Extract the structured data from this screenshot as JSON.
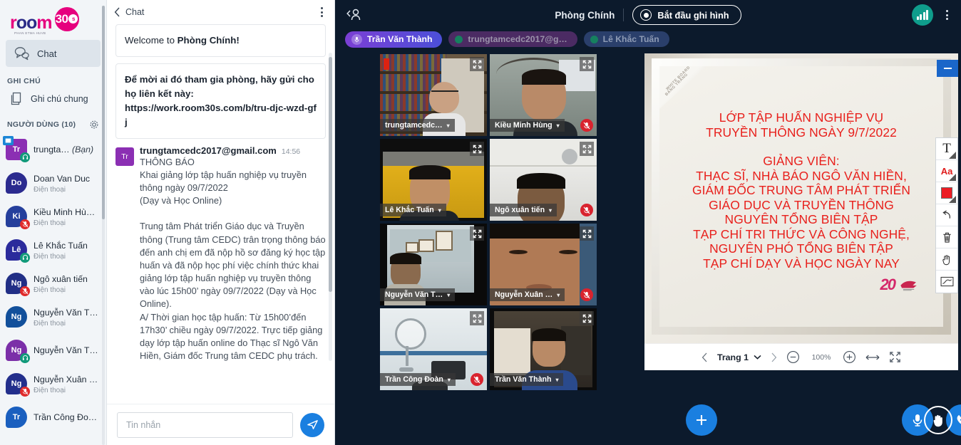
{
  "sidebar": {
    "brand": {
      "word_r": "r",
      "word_o1": "o",
      "word_o2": "o",
      "word_m": "m",
      "tagline": "PHAN ETMA HUVB",
      "badge_num": "30",
      "badge_s": "s"
    },
    "chat_item": {
      "label": "Chat",
      "icon": "chat-bubble-icon"
    },
    "notes_section_title": "GHI CHÚ",
    "notes_item": {
      "label": "Ghi chú chung",
      "icon": "document-icon"
    },
    "users_section_title": "NGƯỜI DÙNG (10)",
    "users_gear_icon": "gear-icon",
    "users": [
      {
        "initials": "Tr",
        "name": "trungta…",
        "suffix": "(Bạn)",
        "sub": "",
        "avatar_color": "#8b2fb3",
        "shape": "square",
        "badge_tl": "screen-share-icon",
        "badge_br": "headset-icon",
        "badge_br_color": "green"
      },
      {
        "initials": "Do",
        "name": "Doan Van Duc",
        "suffix": "",
        "sub": "Điện thoại",
        "avatar_color": "#2b2b8f",
        "shape": "round",
        "badge_tl": "",
        "badge_br": "",
        "badge_br_color": ""
      },
      {
        "initials": "Ki",
        "name": "Kiều Minh Hù…",
        "suffix": "",
        "sub": "Điện thoại",
        "avatar_color": "#253f9c",
        "shape": "round",
        "badge_tl": "",
        "badge_br": "mic-off-icon",
        "badge_br_color": "red"
      },
      {
        "initials": "Lê",
        "name": "Lê Khắc Tuấn",
        "suffix": "",
        "sub": "Điện thoại",
        "avatar_color": "#2b2b9c",
        "shape": "round",
        "badge_tl": "",
        "badge_br": "headset-icon",
        "badge_br_color": "green"
      },
      {
        "initials": "Ng",
        "name": "Ngô xuân tiến",
        "suffix": "",
        "sub": "Điện thoại",
        "avatar_color": "#212f86",
        "shape": "round",
        "badge_tl": "",
        "badge_br": "mic-off-icon",
        "badge_br_color": "red"
      },
      {
        "initials": "Ng",
        "name": "Nguyễn Văn T…",
        "suffix": "",
        "sub": "Điện thoại",
        "avatar_color": "#12509b",
        "shape": "round",
        "badge_tl": "",
        "badge_br": "",
        "badge_br_color": ""
      },
      {
        "initials": "Ng",
        "name": "Nguyễn Văn T…",
        "suffix": "",
        "sub": "",
        "avatar_color": "#7b2fa8",
        "shape": "round",
        "badge_tl": "",
        "badge_br": "headset-icon",
        "badge_br_color": "green"
      },
      {
        "initials": "Ng",
        "name": "Nguyễn Xuân …",
        "suffix": "",
        "sub": "Điện thoại",
        "avatar_color": "#232f8c",
        "shape": "round",
        "badge_tl": "",
        "badge_br": "mic-off-icon",
        "badge_br_color": "red"
      },
      {
        "initials": "Tr",
        "name": "Trần Công Đo…",
        "suffix": "",
        "sub": "",
        "avatar_color": "#1a5fbf",
        "shape": "round",
        "badge_tl": "",
        "badge_br": "",
        "badge_br_color": ""
      }
    ]
  },
  "chat": {
    "back_icon": "chevron-left-icon",
    "title": "Chat",
    "menu_icon": "kebab-menu-icon",
    "welcome": {
      "plain": "Welcome to ",
      "bold": "Phòng Chính!"
    },
    "invite": {
      "line1": "Để mời ai đó tham gia phòng, hãy gửi cho họ liên kết này:",
      "link": "https://work.room30s.com/b/tru-djc-wzd-gfj"
    },
    "message": {
      "avatar_initials": "Tr",
      "from": "trungtamcedc2017@gmail.com",
      "time": "14:56",
      "body": "THÔNG BÁO\nKhai giảng lớp tập huấn nghiệp vụ truyền thông ngày 09/7/2022\n(Dạy và Học Online)\n\nTrung tâm Phát triển Giáo dục và Truyền thông (Trung tâm CEDC) trân trọng thông báo đến anh chị em đã nộp hồ sơ đăng ký học tập huấn và đã nộp học phí việc chính thức khai giảng lớp tập huấn nghiệp vụ truyền thông vào lúc 15h00’ ngày 09/7/2022 (Dạy và Học Online).\nA/ Thời gian học tập huấn: Từ 15h00’đến 17h30’ chiều ngày 09/7/2022. Trực tiếp giảng dạy lớp tập huấn online do Thạc sĩ Ngô Văn Hiền, Giám đốc Trung tâm CEDC phụ trách."
    },
    "input_placeholder": "Tin nhắn",
    "send_icon": "send-paper-plane-icon"
  },
  "meeting": {
    "people_back_icon": "people-back-icon",
    "room_title": "Phòng Chính",
    "record_button": "Bắt đầu ghi hình",
    "record_icon": "record-dot-icon",
    "signal_icon": "signal-bars-icon",
    "menu_icon": "kebab-menu-icon",
    "chips": [
      {
        "label": "Trần Văn Thành",
        "style": "active",
        "icon": "mic-icon"
      },
      {
        "label": "trungtamcedc2017@g…",
        "style": "c2",
        "icon": "status-dot-icon"
      },
      {
        "label": "Lê Khắc Tuấn",
        "style": "c3",
        "icon": "status-dot-icon"
      }
    ],
    "tiles": [
      {
        "name": "trungtamcedc…",
        "muted": false,
        "selected": false,
        "scene": "bookshelf"
      },
      {
        "name": "Kiều Minh Hùng",
        "muted": true,
        "selected": false,
        "scene": "man-arch"
      },
      {
        "name": "Lê Khắc Tuấn",
        "muted": false,
        "selected": false,
        "scene": "yellow-wall"
      },
      {
        "name": "Ngô xuân tiến",
        "muted": true,
        "selected": false,
        "scene": "white-ceiling"
      },
      {
        "name": "Nguyễn Văn T…",
        "muted": false,
        "selected": false,
        "scene": "office-frames"
      },
      {
        "name": "Nguyễn Xuân …",
        "muted": true,
        "selected": false,
        "scene": "closeup-face"
      },
      {
        "name": "Trần Công Đoàn",
        "muted": true,
        "selected": false,
        "scene": "fan-wall"
      },
      {
        "name": "Trần Văn Thành",
        "muted": false,
        "selected": true,
        "scene": "blue-shirt"
      }
    ],
    "slide": {
      "minimize_icon": "minimize-icon",
      "watermark_line1": "WHITE BOARD",
      "watermark_line2": "BẢNG TRẮNG",
      "title_lines": [
        "LỚP TẬP HUẤN NGHIỆP VỤ",
        "TRUYỀN THÔNG NGÀY 9/7/2022"
      ],
      "body_lines": [
        "GIẢNG VIÊN:",
        "THẠC SĨ, NHÀ BÁO NGÔ VĂN HIỀN,",
        "GIÁM ĐỐC TRUNG TÂM PHÁT TRIỂN",
        "GIÁO DỤC VÀ TRUYỀN THÔNG",
        "NGUYÊN TỔNG BIÊN TẬP",
        "TẠP CHÍ TRI THỨC VÀ CÔNG NGHỆ,",
        "NGUYÊN PHÓ TỔNG BIÊN TẬP",
        "TẠP CHÍ DẠY VÀ HỌC NGÀY NAY"
      ],
      "logo_text": "20",
      "text_color": "#e8201c"
    },
    "whiteboard_tools": [
      {
        "name": "text-tool",
        "glyph": "T",
        "has_caret": true
      },
      {
        "name": "font-size-tool",
        "glyph": "Aa",
        "has_caret": true
      },
      {
        "name": "color-swatch-tool",
        "glyph": "",
        "has_caret": true,
        "color": "#ec1c24"
      },
      {
        "name": "undo-tool",
        "glyph": "",
        "has_caret": false
      },
      {
        "name": "trash-tool",
        "glyph": "",
        "has_caret": false
      },
      {
        "name": "pan-hand-tool",
        "glyph": "",
        "has_caret": false
      },
      {
        "name": "line-tool",
        "glyph": "",
        "has_caret": false
      }
    ],
    "slide_footer": {
      "prev_icon": "chevron-left-icon",
      "page_label": "Trang 1",
      "page_caret_icon": "chevron-down-icon",
      "next_icon": "chevron-right-icon",
      "zoom_out_icon": "minus-circle-icon",
      "zoom_level": "100%",
      "zoom_in_icon": "plus-circle-icon",
      "fit_width_icon": "fit-width-icon",
      "fullscreen_icon": "fullscreen-icon"
    },
    "controls": {
      "add_button": "plus-icon",
      "mic_button": "microphone-icon",
      "phone_button": "phone-icon",
      "camera_button": "video-camera-icon",
      "share_button": "screen-share-icon",
      "hand_button": "raise-hand-icon"
    }
  }
}
